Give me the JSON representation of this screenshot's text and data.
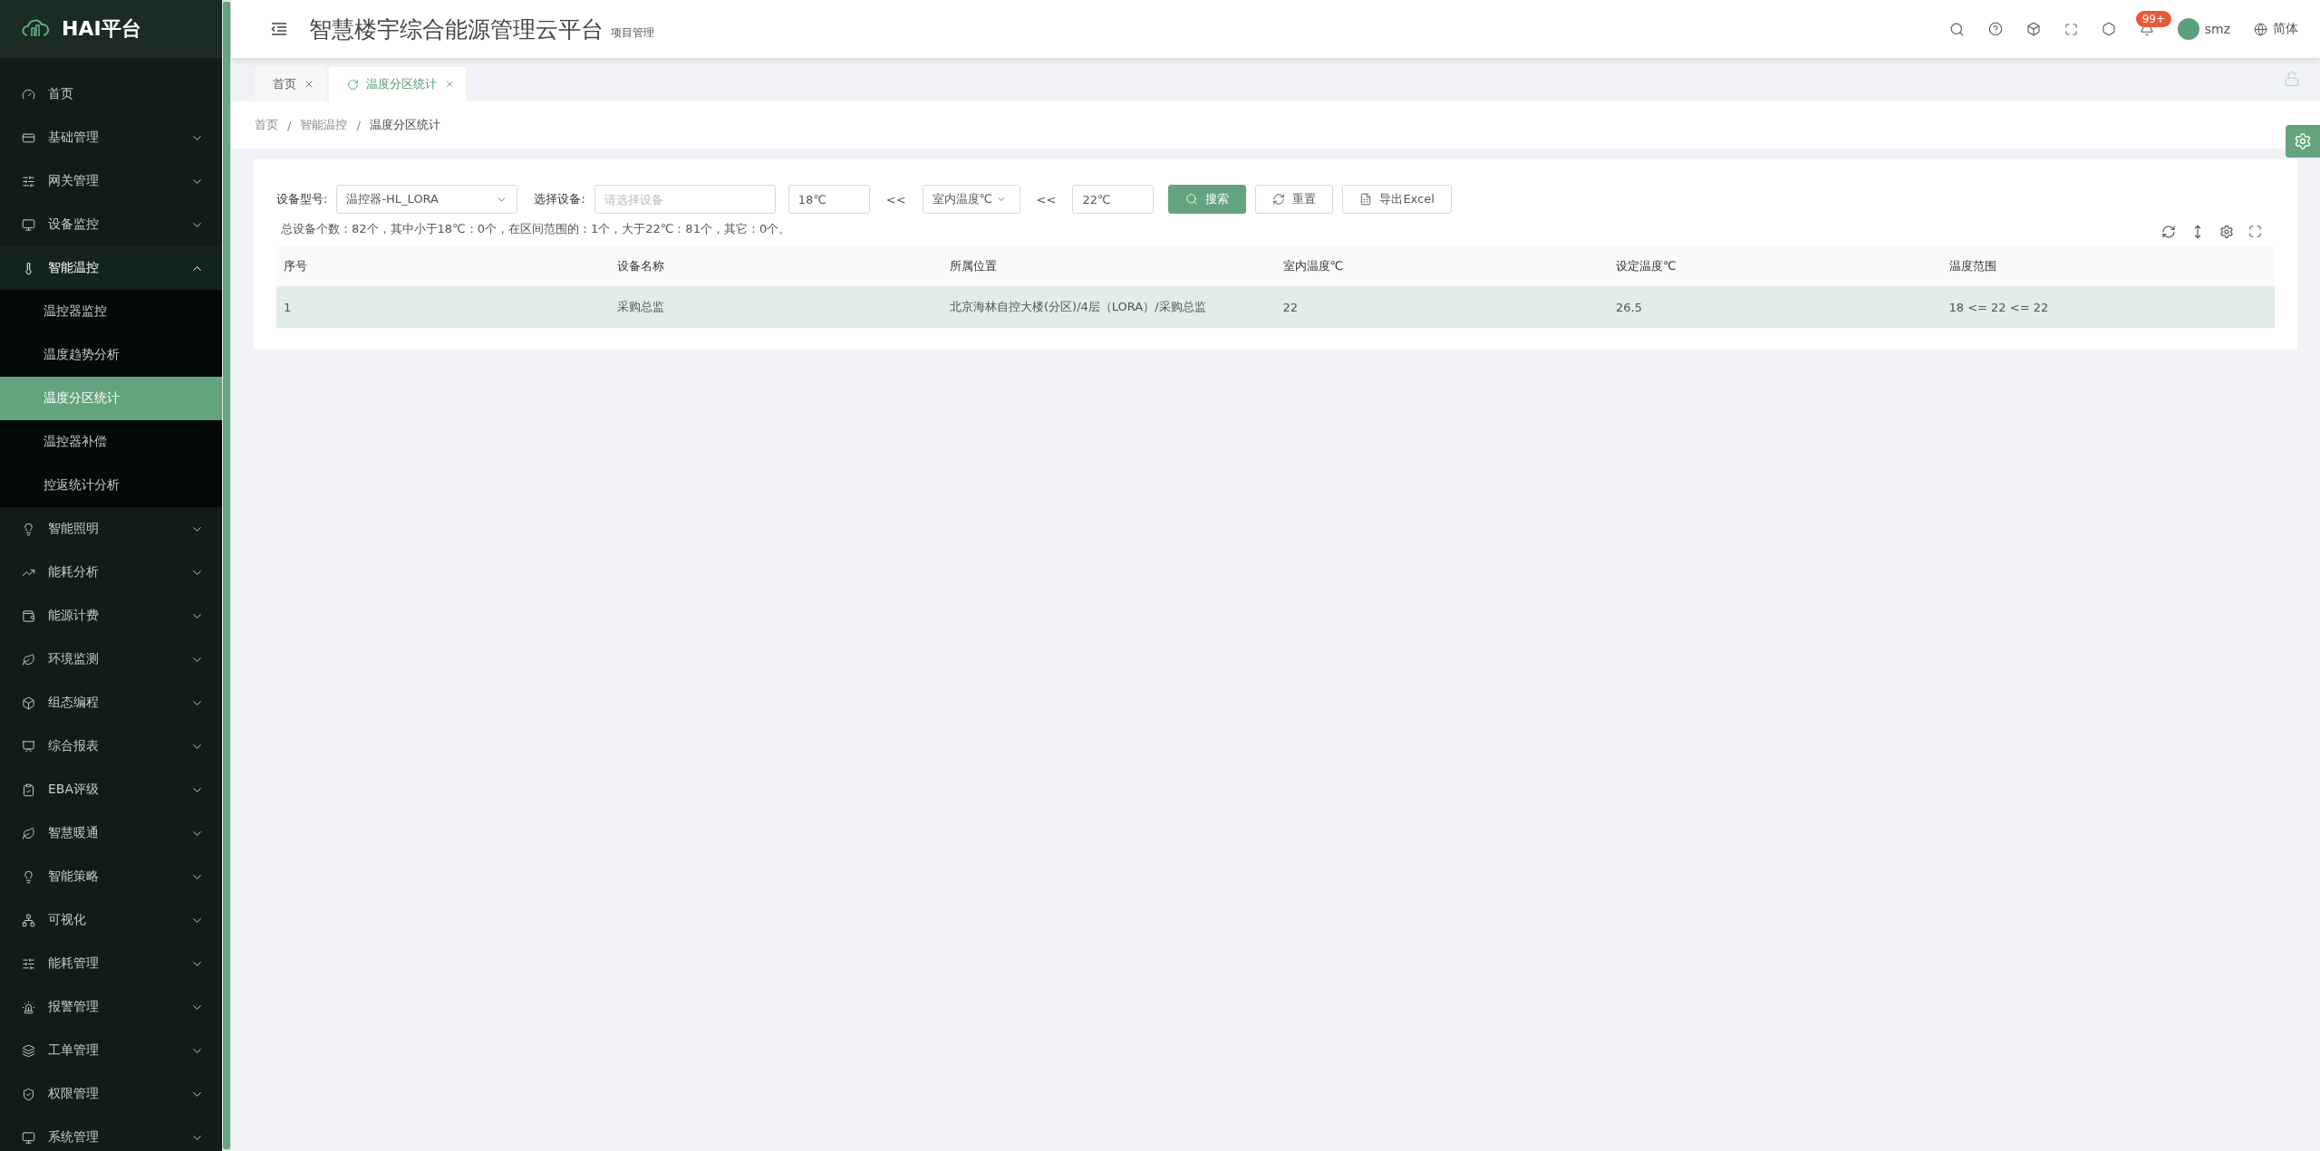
{
  "sidebar": {
    "logo_text": "HAI平台",
    "items": [
      {
        "label": "首页",
        "kind": "link"
      },
      {
        "label": "基础管理",
        "kind": "group",
        "expanded": false
      },
      {
        "label": "网关管理",
        "kind": "group",
        "expanded": false
      },
      {
        "label": "设备监控",
        "kind": "group",
        "expanded": false
      },
      {
        "label": "智能温控",
        "kind": "group",
        "expanded": true,
        "children": [
          {
            "label": "温控器监控",
            "selected": false
          },
          {
            "label": "温度趋势分析",
            "selected": false
          },
          {
            "label": "温度分区统计",
            "selected": true
          },
          {
            "label": "温控器补偿",
            "selected": false
          },
          {
            "label": "控返统计分析",
            "selected": false
          }
        ]
      },
      {
        "label": "智能照明",
        "kind": "group",
        "expanded": false
      },
      {
        "label": "能耗分析",
        "kind": "group",
        "expanded": false
      },
      {
        "label": "能源计费",
        "kind": "group",
        "expanded": false
      },
      {
        "label": "环境监测",
        "kind": "group",
        "expanded": false
      },
      {
        "label": "组态编程",
        "kind": "group",
        "expanded": false
      },
      {
        "label": "综合报表",
        "kind": "group",
        "expanded": false
      },
      {
        "label": "EBA评级",
        "kind": "group",
        "expanded": false
      },
      {
        "label": "智慧暖通",
        "kind": "group",
        "expanded": false
      },
      {
        "label": "智能策略",
        "kind": "group",
        "expanded": false
      },
      {
        "label": "可视化",
        "kind": "group",
        "expanded": false
      },
      {
        "label": "能耗管理",
        "kind": "group",
        "expanded": false
      },
      {
        "label": "报警管理",
        "kind": "group",
        "expanded": false
      },
      {
        "label": "工单管理",
        "kind": "group",
        "expanded": false
      },
      {
        "label": "权限管理",
        "kind": "group",
        "expanded": false
      },
      {
        "label": "系统管理",
        "kind": "group",
        "expanded": false
      }
    ]
  },
  "header": {
    "title": "智慧楼宇综合能源管理云平台",
    "subtitle": "项目管理",
    "notification_badge": "99+",
    "user": "smz",
    "language": "简体"
  },
  "tabs": [
    {
      "label": "首页",
      "selected": false
    },
    {
      "label": "温度分区统计",
      "selected": true
    }
  ],
  "breadcrumb": [
    "首页",
    "智能温控",
    "温度分区统计"
  ],
  "breadcrumb_separator": "/",
  "filters": {
    "device_type_label": "设备型号:",
    "device_type_value": "温控器-HL_LORA",
    "device_label": "选择设备:",
    "device_placeholder": "请选择设备",
    "min_value": "18℃",
    "separator_1": "<<",
    "metric_value": "室内温度℃",
    "separator_2": "<<",
    "max_value": "22℃",
    "buttons": [
      {
        "label": "搜索",
        "kind": "primary"
      },
      {
        "label": "重置",
        "kind": "reset"
      },
      {
        "label": "导出Excel",
        "kind": "export"
      }
    ]
  },
  "summary": "总设备个数：82个，其中小于18℃：0个，在区间范围的：1个，大于22℃：81个，其它：0个。",
  "table": {
    "columns": [
      "序号",
      "设备名称",
      "所属位置",
      "室内温度℃",
      "设定温度℃",
      "温度范围"
    ],
    "rows": [
      {
        "selected": true,
        "cells": [
          "1",
          "采购总监",
          "北京海林自控大楼(分区)/4层（LORA）/采购总监",
          "22",
          "26.5",
          "18 <= 22 <= 22"
        ]
      }
    ]
  }
}
